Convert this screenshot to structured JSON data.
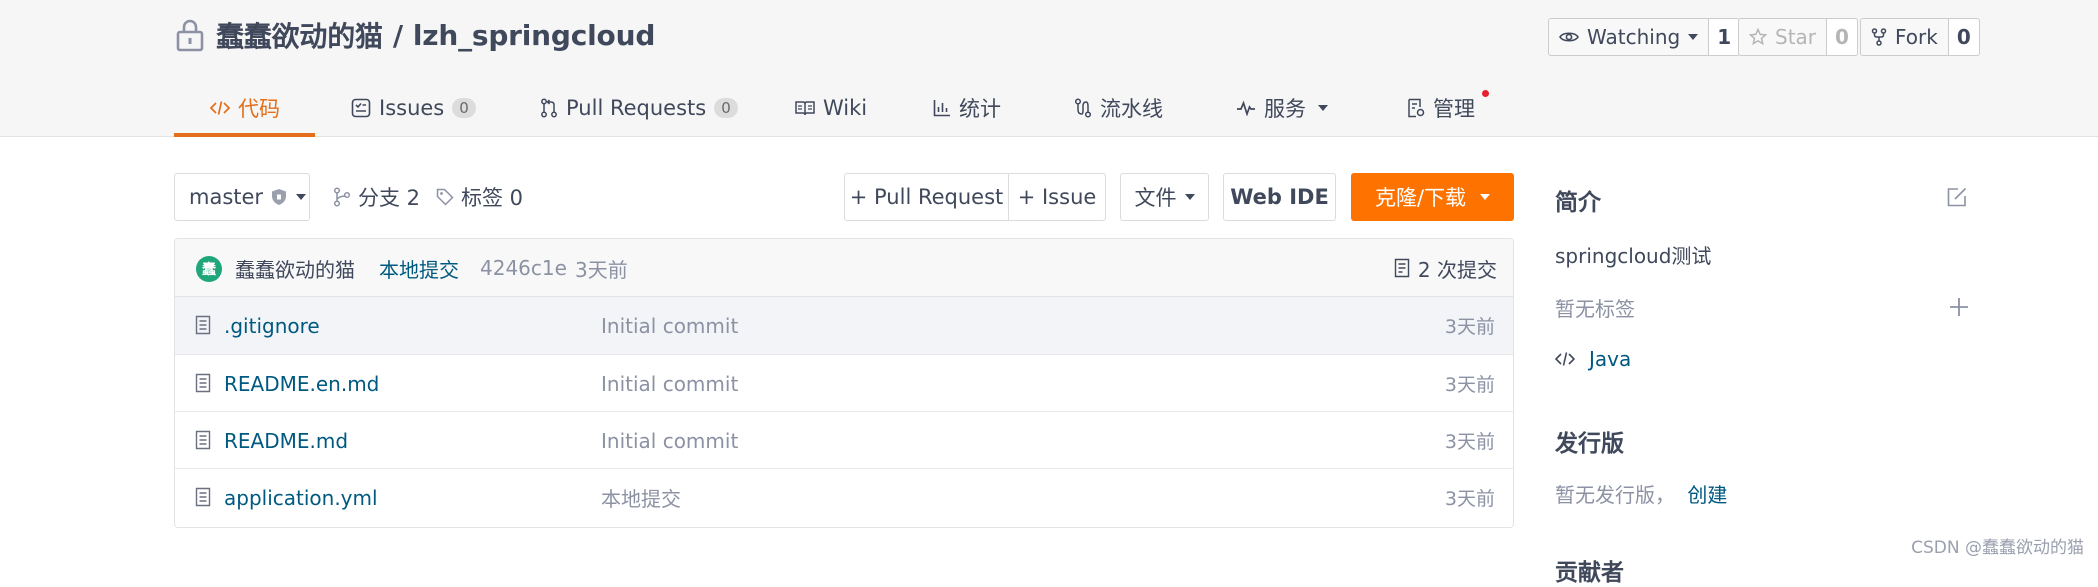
{
  "header": {
    "owner": "蠢蠢欲动的猫",
    "separator": "/",
    "repo": "lzh_springcloud",
    "watch": {
      "label": "Watching",
      "count": "1"
    },
    "star": {
      "label": "Star",
      "count": "0"
    },
    "fork": {
      "label": "Fork",
      "count": "0"
    }
  },
  "tabs": [
    {
      "label": "代码",
      "icon": "code-icon",
      "active": true
    },
    {
      "label": "Issues",
      "icon": "issues-icon",
      "badge": "0"
    },
    {
      "label": "Pull Requests",
      "icon": "pull-request-icon",
      "badge": "0"
    },
    {
      "label": "Wiki",
      "icon": "book-icon"
    },
    {
      "label": "统计",
      "icon": "bar-chart-icon"
    },
    {
      "label": "流水线",
      "icon": "pipeline-icon"
    },
    {
      "label": "服务",
      "icon": "pulse-icon",
      "dropdown": true
    },
    {
      "label": "管理",
      "icon": "settings-doc-icon",
      "notification": true
    }
  ],
  "toolbar": {
    "branch": "master",
    "branches": "分支 2",
    "tags": "标签 0",
    "pull_request": "+ Pull Request",
    "issue": "+ Issue",
    "file": "文件",
    "web_ide": "Web IDE",
    "clone": "克隆/下载"
  },
  "commit": {
    "avatar_letter": "蠢",
    "author": "蠢蠢欲动的猫",
    "message": "本地提交",
    "hash": "4246c1e",
    "time": "3天前",
    "total": "2 次提交"
  },
  "files": [
    {
      "name": ".gitignore",
      "message": "Initial commit",
      "time": "3天前"
    },
    {
      "name": "README.en.md",
      "message": "Initial commit",
      "time": "3天前"
    },
    {
      "name": "README.md",
      "message": "Initial commit",
      "time": "3天前"
    },
    {
      "name": "application.yml",
      "message": "本地提交",
      "time": "3天前"
    }
  ],
  "sidebar": {
    "intro_title": "简介",
    "description": "springcloud测试",
    "no_tags": "暂无标签",
    "language": "Java",
    "release_title": "发行版",
    "no_release": "暂无发行版，",
    "create": "创建",
    "contributors_partial": "贡献者"
  },
  "watermark": "CSDN @蠢蠢欲动的猫",
  "colors": {
    "accent": "#e46e19",
    "clone": "#fe7300",
    "link": "#005980",
    "avatar": "#1fa67a"
  }
}
